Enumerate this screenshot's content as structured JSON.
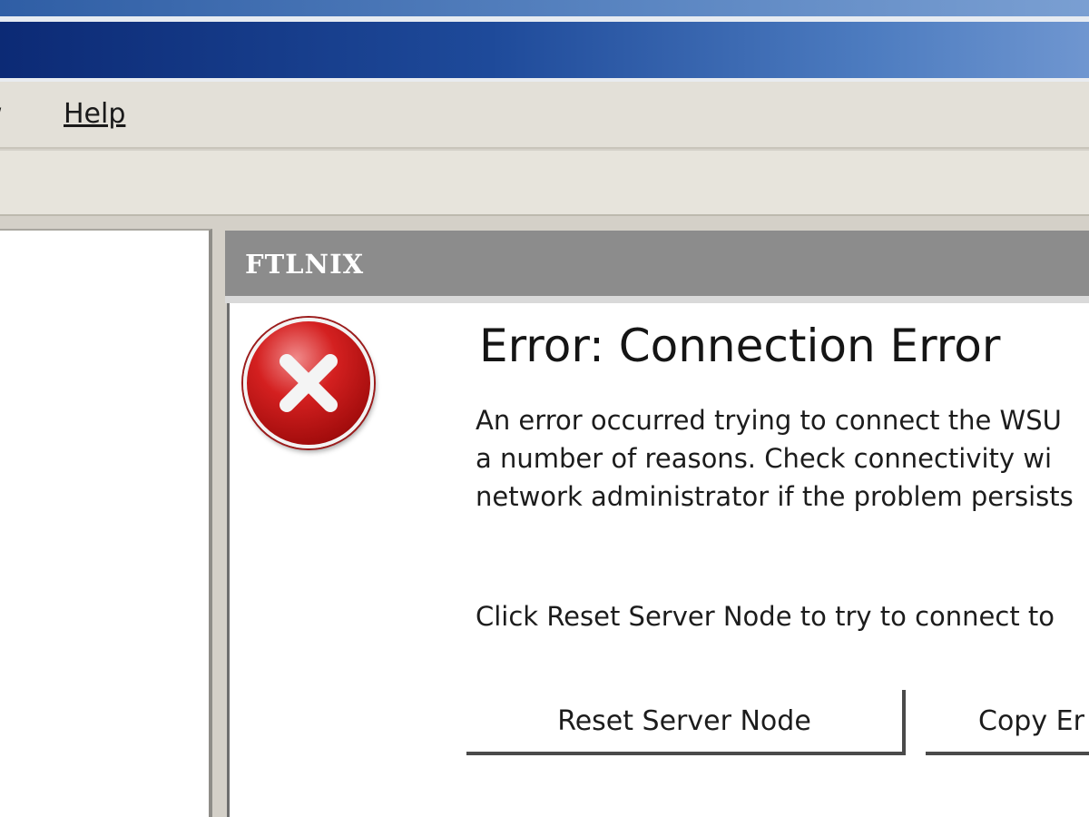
{
  "menu": {
    "view_label_partial": "w",
    "help_label": "Help"
  },
  "panel": {
    "title": "FTLNIX"
  },
  "error": {
    "icon": "error-x-icon",
    "heading": "Error: Connection Error",
    "message_lines": [
      "An error occurred trying to connect the WSU",
      "a number of reasons. Check connectivity wi",
      "network administrator if the problem persists"
    ],
    "instruction": "Click Reset Server Node to try to connect to"
  },
  "buttons": {
    "reset_label": "Reset Server Node",
    "copy_label": "Copy Er"
  },
  "colors": {
    "titlebar": "#1e4a9a",
    "panel_header": "#8c8c8c",
    "error_red": "#d42020"
  }
}
